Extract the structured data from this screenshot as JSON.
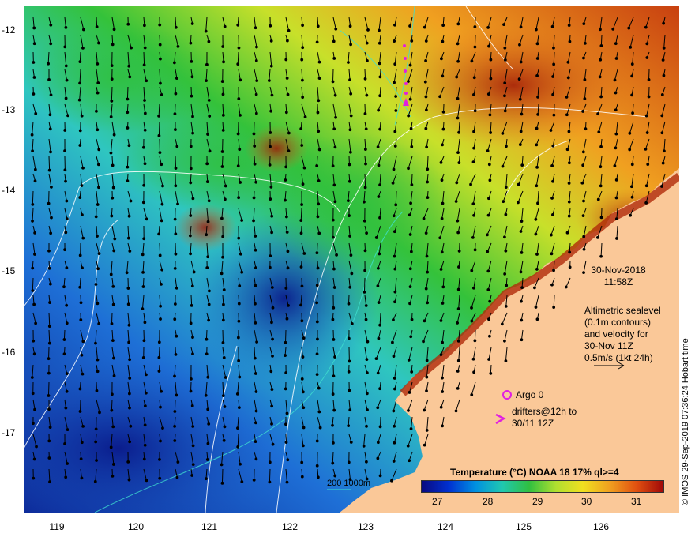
{
  "map": {
    "lat_labels": [
      "-12",
      "-13",
      "-14",
      "-15",
      "-16",
      "-17"
    ],
    "lon_labels": [
      "119",
      "120",
      "121",
      "122",
      "123",
      "124",
      "125",
      "126"
    ]
  },
  "overlay": {
    "date": "30-Nov-2018",
    "time": "11:58Z",
    "altimetry_lines": [
      "Altimetric sealevel",
      "(0.1m contours)",
      "and velocity for",
      "30-Nov 11Z",
      "0.5m/s (1kt 24h)"
    ],
    "argo_label": "Argo 0",
    "drifters_label_1": "drifters@12h to",
    "drifters_label_2": "30/11 12Z",
    "depth_legend": "200  1000m"
  },
  "colorbar": {
    "title": "Temperature (°C) NOAA 18 17% ql>=4",
    "ticks": [
      "27",
      "28",
      "29",
      "30",
      "31"
    ]
  },
  "credit": "© IMOS 29-Sep-2019 07:36:24 Hobart time",
  "colors": {
    "land": "#fac898",
    "marker": "#e020e0",
    "contour": "#ffffff",
    "depth_line": "#40e0d0"
  }
}
